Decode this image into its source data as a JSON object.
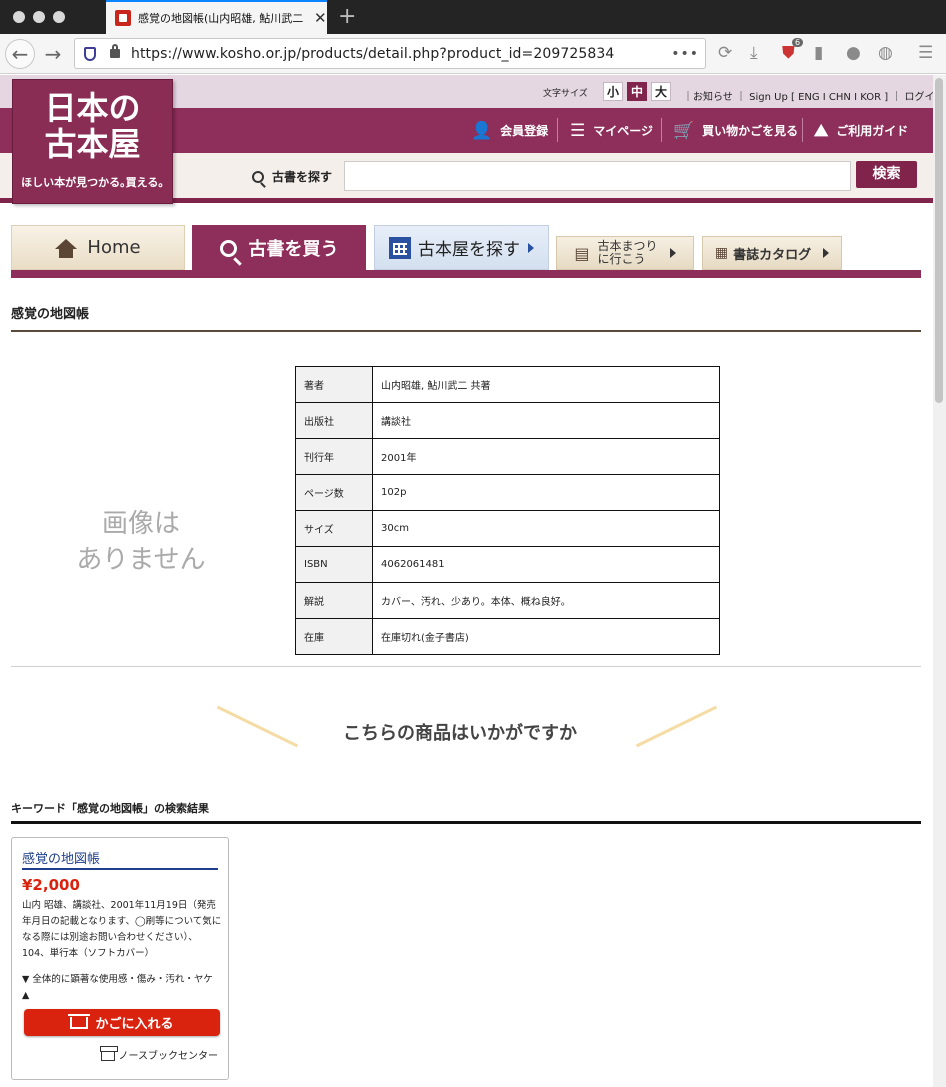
{
  "browser": {
    "tab_title": "感覚の地図帳(山内昭雄, 鮎川武二",
    "url": "https://www.kosho.or.jp/products/detail.php?product_id=209725834",
    "url_menu": "•••",
    "new_tab": "+",
    "close": "✕",
    "badge_count": "6"
  },
  "site": {
    "logo_line1": "日本の",
    "logo_line2": "古本屋",
    "logo_tagline": "ほしい本が見つかる｡買える｡",
    "fontsize_label": "文字サイズ",
    "fontsize_options": [
      "小",
      "中",
      "大"
    ],
    "top_links": "｜お知らせ ｜ Sign Up [ ENG I CHN I KOR ] ｜ ログイン ｜",
    "menu": {
      "register": "会員登録",
      "mypage": "マイページ",
      "cart": "買い物かごを見る",
      "guide": "ご利用ガイド"
    },
    "search_label": "古書を探す",
    "search_placeholder": "",
    "search_button": "検索"
  },
  "nav_tabs": {
    "home": "Home",
    "buy": "古書を買う",
    "shops": "古本屋を探す",
    "festival_line1": "古本まつり",
    "festival_line2": "に行こう",
    "catalog": "書誌カタログ"
  },
  "product": {
    "title": "感覚の地図帳",
    "no_image_line1": "画像は",
    "no_image_line2": "ありません",
    "details": [
      {
        "key": "著者",
        "value": "山内昭雄, 鮎川武二 共著"
      },
      {
        "key": "出版社",
        "value": "講談社"
      },
      {
        "key": "刊行年",
        "value": "2001年"
      },
      {
        "key": "ページ数",
        "value": "102p"
      },
      {
        "key": "サイズ",
        "value": "30cm"
      },
      {
        "key": "ISBN",
        "value": "4062061481"
      },
      {
        "key": "解説",
        "value": "カバー、汚れ、少あり。本体、概ね良好。"
      },
      {
        "key": "在庫",
        "value": "在庫切れ(金子書店)"
      }
    ]
  },
  "recommend": {
    "heading": "こちらの商品はいかがですか",
    "keyword_title": "キーワード「感覚の地図帳」の検索結果",
    "items": [
      {
        "title": "感覚の地図帳",
        "price": "¥2,000",
        "description": "山内 昭雄、講談社、2001年11月19日（発売年月日の記載となります、◯刷等について気になる際には別途お問い合わせください）、104、単行本（ソフトカバー）",
        "condition": "▼ 全体的に顕著な使用感・傷み・汚れ・ヤケ ▲",
        "cart_button": "かごに入れる",
        "shop": "ノースブックセンター"
      }
    ]
  }
}
